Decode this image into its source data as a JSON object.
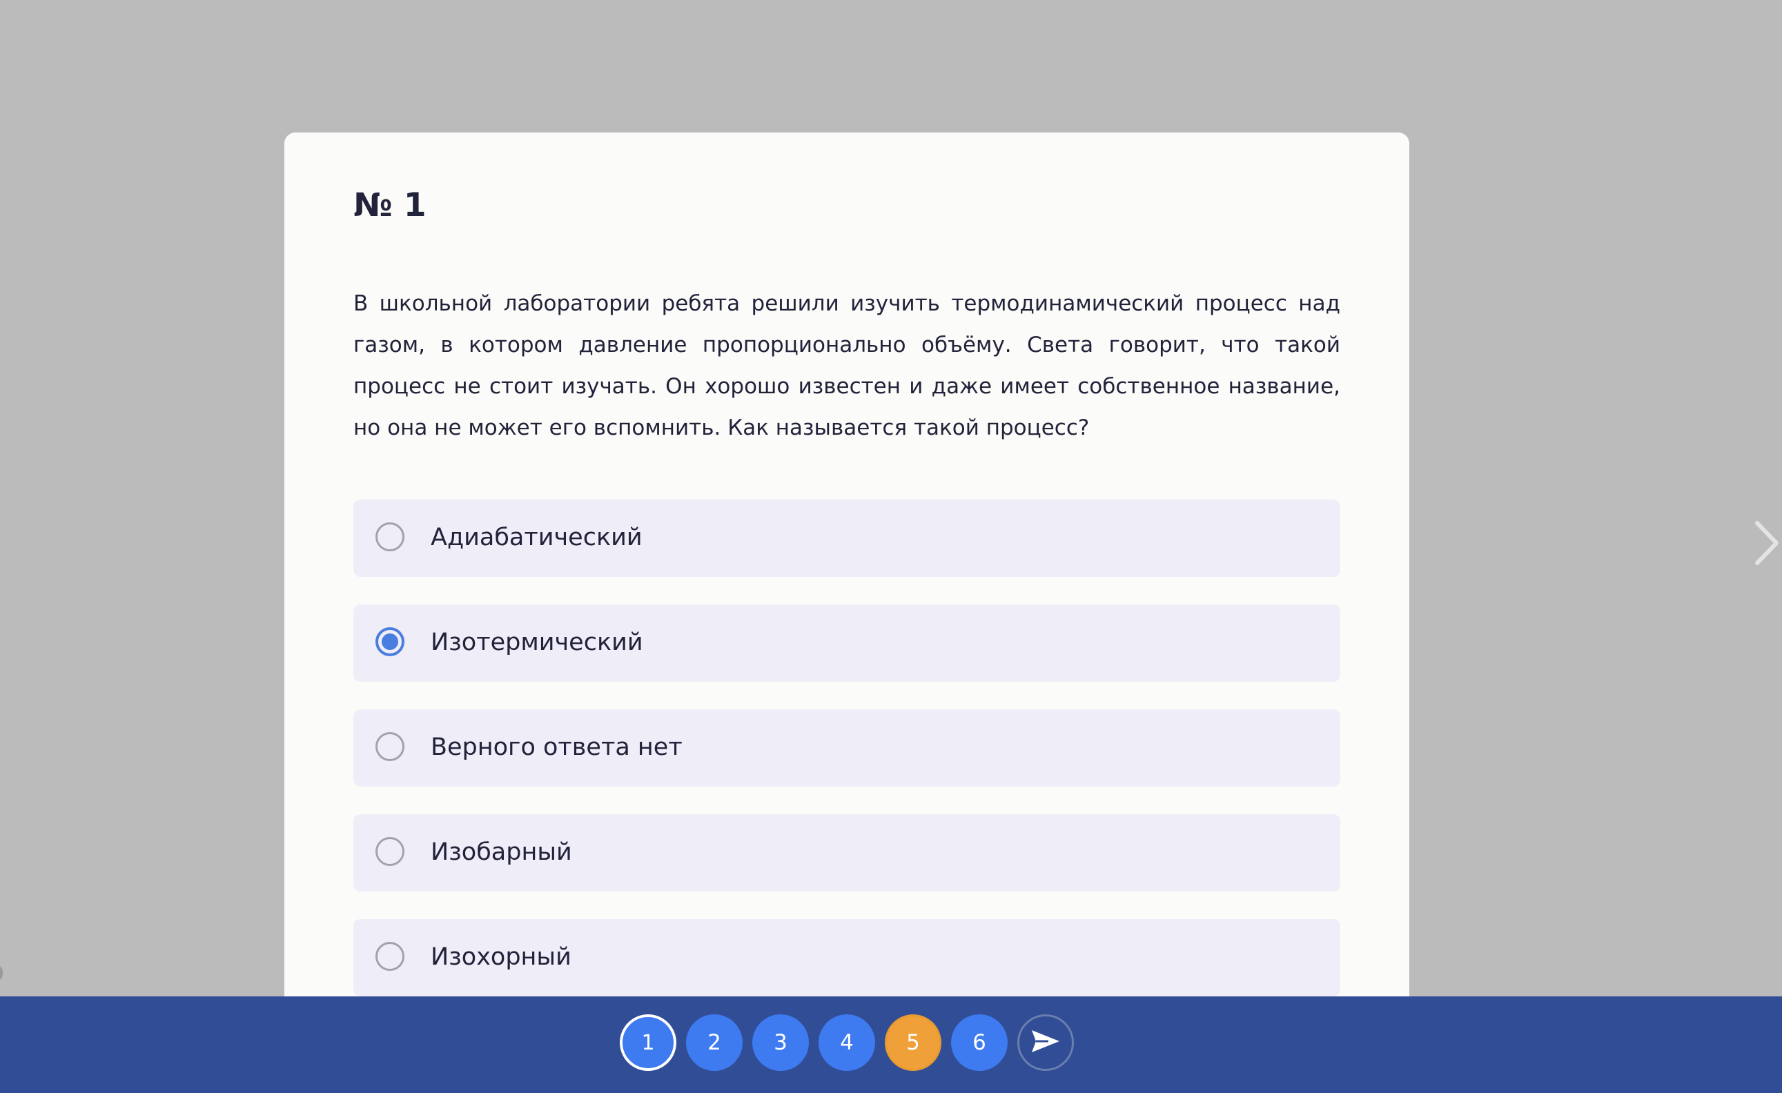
{
  "question": {
    "number_label": "№ 1",
    "text": "В школьной лаборатории ребята решили изучить термодинамический процесс над газом, в котором давление пропорционально объёму. Света говорит, что такой процесс не стоит изучать. Он хорошо известен и даже имеет собственное название, но она не может его вспомнить. Как называется такой процесс?"
  },
  "options": [
    {
      "label": "Адиабатический",
      "selected": false
    },
    {
      "label": "Изотермический",
      "selected": true
    },
    {
      "label": "Верного ответа нет",
      "selected": false
    },
    {
      "label": "Изобарный",
      "selected": false
    },
    {
      "label": "Изохорный",
      "selected": false
    }
  ],
  "pager": {
    "pages": [
      "1",
      "2",
      "3",
      "4",
      "5",
      "6"
    ],
    "current_page": "1",
    "highlighted_page": "5"
  },
  "colors": {
    "accent_blue": "#3e7af0",
    "bar_blue": "#314d96",
    "highlight_orange": "#f0a038",
    "option_bg": "#efedf8"
  },
  "icons": {
    "next_arrow": "chevron-right-icon",
    "send": "send-icon"
  }
}
